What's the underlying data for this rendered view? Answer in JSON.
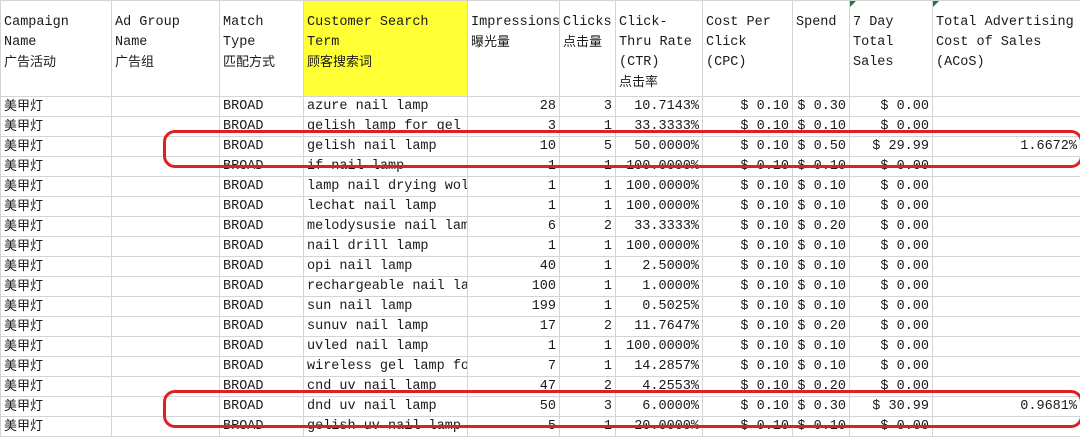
{
  "headers": [
    {
      "line1": "Campaign Name",
      "line2": "广告活动"
    },
    {
      "line1": "Ad Group Name",
      "line2": "广告组"
    },
    {
      "line1": "Match Type",
      "line2": "匹配方式"
    },
    {
      "line1": "Customer Search Term",
      "line2": "顾客搜索词",
      "highlight": true
    },
    {
      "line1": "Impressions",
      "line2": "曝光量"
    },
    {
      "line1": "Clicks",
      "line2": "点击量"
    },
    {
      "line1": "Click-Thru Rate (CTR)",
      "line2": "点击率"
    },
    {
      "line1": "Cost Per Click (CPC)",
      "line2": ""
    },
    {
      "line1": "Spend",
      "line2": ""
    },
    {
      "line1": "7 Day Total Sales",
      "line2": ""
    },
    {
      "line1": "Total Advertising Cost of Sales (ACoS)",
      "line2": ""
    }
  ],
  "rows": [
    [
      "美甲灯",
      "",
      "BROAD",
      "azure nail lamp",
      "28",
      "3",
      "10.7143%",
      "$ 0.10",
      "$ 0.30",
      "$ 0.00",
      ""
    ],
    [
      "美甲灯",
      "",
      "BROAD",
      "gelish lamp for gel p",
      "3",
      "1",
      "33.3333%",
      "$ 0.10",
      "$ 0.10",
      "$ 0.00",
      ""
    ],
    [
      "美甲灯",
      "",
      "BROAD",
      "gelish nail lamp",
      "10",
      "5",
      "50.0000%",
      "$ 0.10",
      "$ 0.50",
      "$ 29.99",
      "1.6672%"
    ],
    [
      "美甲灯",
      "",
      "BROAD",
      "if nail lamp",
      "1",
      "1",
      "100.0000%",
      "$ 0.10",
      "$ 0.10",
      "$ 0.00",
      ""
    ],
    [
      "美甲灯",
      "",
      "BROAD",
      "lamp nail drying wolt",
      "1",
      "1",
      "100.0000%",
      "$ 0.10",
      "$ 0.10",
      "$ 0.00",
      ""
    ],
    [
      "美甲灯",
      "",
      "BROAD",
      "lechat nail lamp",
      "1",
      "1",
      "100.0000%",
      "$ 0.10",
      "$ 0.10",
      "$ 0.00",
      ""
    ],
    [
      "美甲灯",
      "",
      "BROAD",
      "melodysusie nail lamp",
      "6",
      "2",
      "33.3333%",
      "$ 0.10",
      "$ 0.20",
      "$ 0.00",
      ""
    ],
    [
      "美甲灯",
      "",
      "BROAD",
      "nail drill lamp",
      "1",
      "1",
      "100.0000%",
      "$ 0.10",
      "$ 0.10",
      "$ 0.00",
      ""
    ],
    [
      "美甲灯",
      "",
      "BROAD",
      "opi nail lamp",
      "40",
      "1",
      "2.5000%",
      "$ 0.10",
      "$ 0.10",
      "$ 0.00",
      ""
    ],
    [
      "美甲灯",
      "",
      "BROAD",
      "rechargeable nail lam",
      "100",
      "1",
      "1.0000%",
      "$ 0.10",
      "$ 0.10",
      "$ 0.00",
      ""
    ],
    [
      "美甲灯",
      "",
      "BROAD",
      "sun nail lamp",
      "199",
      "1",
      "0.5025%",
      "$ 0.10",
      "$ 0.10",
      "$ 0.00",
      ""
    ],
    [
      "美甲灯",
      "",
      "BROAD",
      "sunuv nail lamp",
      "17",
      "2",
      "11.7647%",
      "$ 0.10",
      "$ 0.20",
      "$ 0.00",
      ""
    ],
    [
      "美甲灯",
      "",
      "BROAD",
      "uvled nail lamp",
      "1",
      "1",
      "100.0000%",
      "$ 0.10",
      "$ 0.10",
      "$ 0.00",
      ""
    ],
    [
      "美甲灯",
      "",
      "BROAD",
      "wireless gel lamp for",
      "7",
      "1",
      "14.2857%",
      "$ 0.10",
      "$ 0.10",
      "$ 0.00",
      ""
    ],
    [
      "美甲灯",
      "",
      "BROAD",
      "cnd uv nail lamp",
      "47",
      "2",
      "4.2553%",
      "$ 0.10",
      "$ 0.20",
      "$ 0.00",
      ""
    ],
    [
      "美甲灯",
      "",
      "BROAD",
      "dnd uv nail lamp",
      "50",
      "3",
      "6.0000%",
      "$ 0.10",
      "$ 0.30",
      "$ 30.99",
      "0.9681%"
    ],
    [
      "美甲灯",
      "",
      "BROAD",
      "gelish uv nail lamp",
      "5",
      "1",
      "20.0000%",
      "$ 0.10",
      "$ 0.10",
      "$ 0.00",
      ""
    ]
  ],
  "highlighted_rows": [
    2,
    15
  ],
  "colors": {
    "highlight_header": "#ffff33",
    "annotation_box": "#e02020",
    "gridline": "#d4d4d4"
  }
}
